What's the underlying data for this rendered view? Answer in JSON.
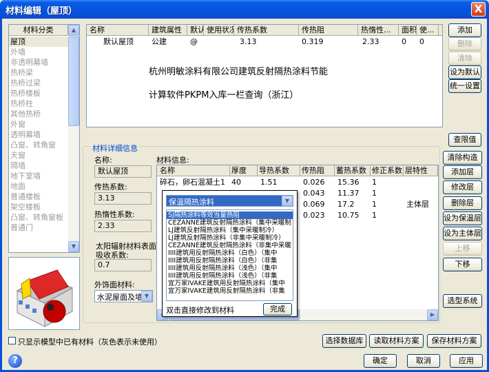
{
  "window": {
    "title": "材料编辑（屋顶）",
    "close_glyph": "X"
  },
  "category_panel": {
    "header": "材料分类",
    "items": [
      "屋顶",
      "外墙",
      "非透明幕墙",
      "热桥梁",
      "热桥过梁",
      "热桥楼板",
      "热桥柱",
      "其他热桥",
      "外窗",
      "透明幕墙",
      "凸窗、转角窗",
      "天窗",
      "隔墙",
      "地下室墙",
      "地面",
      "普通楼板",
      "架空楼板",
      "凸窗、转角窗板",
      "普通门"
    ]
  },
  "material_table": {
    "columns": [
      "名称",
      "建筑属性",
      "默认",
      "使用状况",
      "传热系数",
      "传热阻",
      "热惰性...",
      "面积",
      "使..."
    ],
    "rows": [
      {
        "name": "默认屋顶",
        "attr": "公建",
        "default": "@",
        "status": "",
        "k": "3.13",
        "r": "0.319",
        "d": "2.33",
        "area": "0",
        "use": "0"
      }
    ],
    "overlay_line1": "杭州明敏涂料有限公司建筑反射隔热涂料节能",
    "overlay_line2": "计算软件PKPM入库一栏查询（浙江）"
  },
  "right_buttons": {
    "add": "添加",
    "delete": "删除",
    "clear": "清除",
    "set_default": "设为默认",
    "unify": "统一设置",
    "limits": "查限值"
  },
  "detail": {
    "group_title": "材料详细信息",
    "name_label": "名称:",
    "name_value": "默认屋顶",
    "k_label": "传热系数:",
    "k_value": "3.13",
    "d_label": "热惰性系数:",
    "d_value": "2.33",
    "solar_label_1": "太阳辐射材料表面",
    "solar_label_2": "吸收系数:",
    "solar_value": "0.7",
    "finish_label": "外饰面材料:",
    "finish_value": "水泥屋面及墙面",
    "material_info_label": "材料信息:"
  },
  "layer_table": {
    "columns": [
      "名称",
      "厚度",
      "导热系数",
      "传热阻",
      "蓄热系数",
      "修正系数",
      "层特性"
    ],
    "rows": [
      {
        "name": "碎石，卵石混凝土1",
        "thick": "40",
        "lambda": "1.51",
        "r": "0.026",
        "s": "15.36",
        "a": "1",
        "prop": ""
      },
      {
        "name": "",
        "thick": "",
        "lambda": "",
        "r": "0.043",
        "s": "11.37",
        "a": "1",
        "prop": ""
      },
      {
        "name": "",
        "thick": "",
        "lambda": "",
        "r": "0.069",
        "s": "17.2",
        "a": "1",
        "prop": "主体层"
      },
      {
        "name": "",
        "thick": "",
        "lambda": "",
        "r": "0.023",
        "s": "10.75",
        "a": "1",
        "prop": ""
      }
    ]
  },
  "dropdown": {
    "selected": "保温隔热涂料",
    "options": [
      "SJ隔热涂料等效当量热阻",
      "CEZANNE建筑反射隔热涂料（集中采暖制",
      "LJ建筑反射隔热涂料（集中采暖制冷）",
      "LJ建筑反射隔热涂料（非集中采暖制冷）",
      "CEZANNE建筑反射隔热涂料（非集中采暖",
      "IIII建筑用反射隔热涂料（白色）（集中",
      "IIII建筑用反射隔热涂料（白色）（非集",
      "IIII建筑用反射隔热涂料（浅色）（集中",
      "IIII建筑用反射隔热涂料（浅色）（非集",
      "宜万家IVAKE建筑用反射隔热涂料（集中",
      "宜万家IVAKE建筑用反射隔热涂料（非集"
    ],
    "hint": "双击直接修改到材料",
    "done": "完成"
  },
  "layer_buttons": {
    "clear": "清除构造",
    "add": "添加层",
    "modify": "修改层",
    "delete": "删除层",
    "insulation": "设为保温层",
    "main": "设为主体层",
    "up": "上移",
    "down": "下移",
    "select_system": "选型系统"
  },
  "bottom": {
    "checkbox_label": "只显示模型中已有材料（灰色表示未使用）",
    "select_db": "选择数据库",
    "read_scheme": "读取材料方案",
    "save_scheme": "保存材料方案",
    "ok": "确定",
    "cancel": "取消",
    "apply": "应用",
    "help": "?"
  },
  "colors": {
    "title_blue": "#0553e0",
    "selection_blue": "#316ac5",
    "face": "#ece9d8"
  }
}
